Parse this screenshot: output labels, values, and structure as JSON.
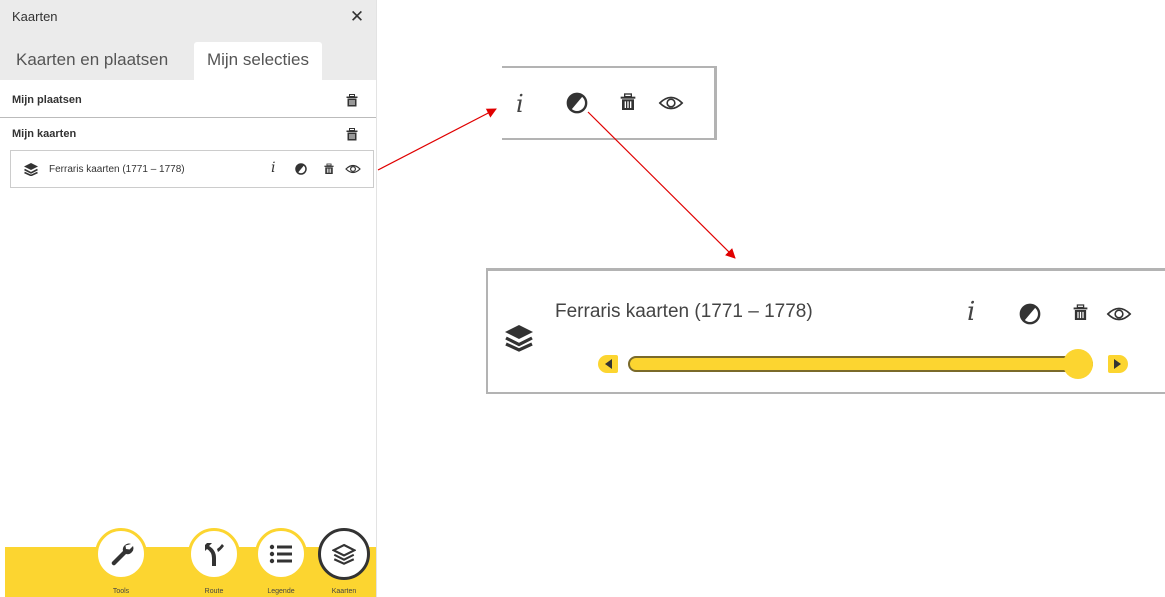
{
  "panel": {
    "title": "Kaarten",
    "close_symbol": "✕",
    "tabs": [
      {
        "label": "Kaarten en plaatsen",
        "active": false
      },
      {
        "label": "Mijn selecties",
        "active": true
      }
    ],
    "sections": [
      {
        "label": "Mijn plaatsen",
        "icon": "trash-icon"
      },
      {
        "label": "Mijn kaarten",
        "icon": "trash-icon"
      }
    ],
    "layer": {
      "name": "Ferraris kaarten (1771 – 1778)",
      "icons": [
        "layers-icon",
        "info-icon",
        "contrast-icon",
        "trash-icon",
        "eye-icon"
      ],
      "info_symbol": "i"
    },
    "nav": [
      {
        "label": "Tools",
        "icon": "wrench-icon"
      },
      {
        "label": "Route",
        "icon": "route-icon"
      },
      {
        "label": "Legende",
        "icon": "list-icon"
      },
      {
        "label": "Kaarten",
        "icon": "layers-icon"
      }
    ]
  },
  "zoom1": {
    "info_symbol": "i",
    "icons": [
      "info-icon",
      "contrast-icon",
      "trash-icon",
      "eye-icon"
    ]
  },
  "zoom2": {
    "name": "Ferraris kaarten (1771 – 1778)",
    "info_symbol": "i",
    "opacity_slider_value": 1.0
  },
  "colors": {
    "accent": "#fcd530",
    "arrow": "#e00000",
    "header_bg": "#ebebeb"
  }
}
